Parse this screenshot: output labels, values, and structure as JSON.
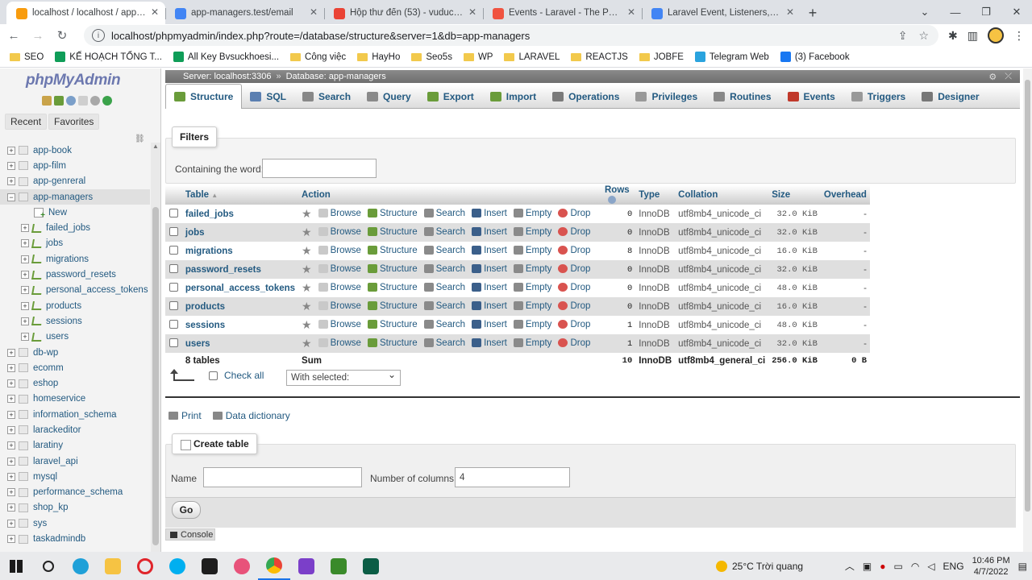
{
  "browser": {
    "tabs": [
      {
        "label": "localhost / localhost / app-mana",
        "active": true,
        "color": "#f89c0e"
      },
      {
        "label": "app-managers.test/email",
        "active": false,
        "color": "#4285f4"
      },
      {
        "label": "Hộp thư đến (53) - vuducnguyen",
        "active": false,
        "color": "#ea4335"
      },
      {
        "label": "Events - Laravel - The PHP Fram",
        "active": false,
        "color": "#f05340"
      },
      {
        "label": "Laravel Event, Listeners, Email &",
        "active": false,
        "color": "#4285f4"
      }
    ],
    "url": "localhost/phpmyadmin/index.php?route=/database/structure&server=1&db=app-managers",
    "bookmarks": [
      {
        "label": "SEO",
        "type": "folder"
      },
      {
        "label": "KẾ HOẠCH TỔNG T...",
        "type": "site",
        "color": "#0f9d58"
      },
      {
        "label": "All Key Bvsuckhoesi...",
        "type": "site",
        "color": "#0f9d58"
      },
      {
        "label": "Công việc",
        "type": "folder"
      },
      {
        "label": "HayHo",
        "type": "folder"
      },
      {
        "label": "Seo5s",
        "type": "folder"
      },
      {
        "label": "WP",
        "type": "folder"
      },
      {
        "label": "LARAVEL",
        "type": "folder"
      },
      {
        "label": "REACTJS",
        "type": "folder"
      },
      {
        "label": "JOBFE",
        "type": "folder"
      },
      {
        "label": "Telegram Web",
        "type": "site",
        "color": "#2aa3de"
      },
      {
        "label": "(3) Facebook",
        "type": "site",
        "color": "#1877f2"
      }
    ]
  },
  "leftpanel": {
    "logo_php": "php",
    "logo_myadmin": "MyAdmin",
    "tabs": [
      "Recent",
      "Favorites"
    ],
    "databases": [
      {
        "name": "app-book",
        "expanded": false
      },
      {
        "name": "app-film",
        "expanded": false
      },
      {
        "name": "app-genreral",
        "expanded": false
      },
      {
        "name": "app-managers",
        "expanded": true,
        "children": [
          "New",
          "failed_jobs",
          "jobs",
          "migrations",
          "password_resets",
          "personal_access_tokens",
          "products",
          "sessions",
          "users"
        ]
      },
      {
        "name": "db-wp",
        "expanded": false
      },
      {
        "name": "ecomm",
        "expanded": false
      },
      {
        "name": "eshop",
        "expanded": false
      },
      {
        "name": "homeservice",
        "expanded": false
      },
      {
        "name": "information_schema",
        "expanded": false
      },
      {
        "name": "larackeditor",
        "expanded": false
      },
      {
        "name": "laratiny",
        "expanded": false
      },
      {
        "name": "laravel_api",
        "expanded": false
      },
      {
        "name": "mysql",
        "expanded": false
      },
      {
        "name": "performance_schema",
        "expanded": false
      },
      {
        "name": "shop_kp",
        "expanded": false
      },
      {
        "name": "sys",
        "expanded": false
      },
      {
        "name": "taskadmindb",
        "expanded": false
      }
    ]
  },
  "breadcrumb": {
    "server": "Server: localhost:3306",
    "database": "Database: app-managers"
  },
  "menu": [
    {
      "label": "Structure",
      "active": true,
      "color": "#6a9c3a"
    },
    {
      "label": "SQL",
      "active": false,
      "color": "#5b7fb1"
    },
    {
      "label": "Search",
      "active": false,
      "color": "#888888"
    },
    {
      "label": "Query",
      "active": false,
      "color": "#8a8a8a"
    },
    {
      "label": "Export",
      "active": false,
      "color": "#6a9c3a"
    },
    {
      "label": "Import",
      "active": false,
      "color": "#6a9c3a"
    },
    {
      "label": "Operations",
      "active": false,
      "color": "#7a7a7a"
    },
    {
      "label": "Privileges",
      "active": false,
      "color": "#999999"
    },
    {
      "label": "Routines",
      "active": false,
      "color": "#888888"
    },
    {
      "label": "Events",
      "active": false,
      "color": "#c0392b"
    },
    {
      "label": "Triggers",
      "active": false,
      "color": "#999999"
    },
    {
      "label": "Designer",
      "active": false,
      "color": "#777777"
    }
  ],
  "filters": {
    "legend": "Filters",
    "label": "Containing the word:",
    "value": ""
  },
  "table": {
    "headers": {
      "table": "Table",
      "action": "Action",
      "rows": "Rows",
      "type": "Type",
      "collation": "Collation",
      "size": "Size",
      "overhead": "Overhead"
    },
    "action_labels": {
      "browse": "Browse",
      "structure": "Structure",
      "search": "Search",
      "insert": "Insert",
      "empty": "Empty",
      "drop": "Drop"
    },
    "rows": [
      {
        "name": "failed_jobs",
        "rows": "0",
        "type": "InnoDB",
        "collation": "utf8mb4_unicode_ci",
        "size": "32.0 KiB",
        "overhead": "-"
      },
      {
        "name": "jobs",
        "rows": "0",
        "type": "InnoDB",
        "collation": "utf8mb4_unicode_ci",
        "size": "32.0 KiB",
        "overhead": "-"
      },
      {
        "name": "migrations",
        "rows": "8",
        "type": "InnoDB",
        "collation": "utf8mb4_unicode_ci",
        "size": "16.0 KiB",
        "overhead": "-"
      },
      {
        "name": "password_resets",
        "rows": "0",
        "type": "InnoDB",
        "collation": "utf8mb4_unicode_ci",
        "size": "32.0 KiB",
        "overhead": "-"
      },
      {
        "name": "personal_access_tokens",
        "rows": "0",
        "type": "InnoDB",
        "collation": "utf8mb4_unicode_ci",
        "size": "48.0 KiB",
        "overhead": "-"
      },
      {
        "name": "products",
        "rows": "0",
        "type": "InnoDB",
        "collation": "utf8mb4_unicode_ci",
        "size": "16.0 KiB",
        "overhead": "-"
      },
      {
        "name": "sessions",
        "rows": "1",
        "type": "InnoDB",
        "collation": "utf8mb4_unicode_ci",
        "size": "48.0 KiB",
        "overhead": "-"
      },
      {
        "name": "users",
        "rows": "1",
        "type": "InnoDB",
        "collation": "utf8mb4_unicode_ci",
        "size": "32.0 KiB",
        "overhead": "-"
      }
    ],
    "footer": {
      "count": "8 tables",
      "sum": "Sum",
      "rows": "10",
      "type": "InnoDB",
      "collation": "utf8mb4_general_ci",
      "size": "256.0 KiB",
      "overhead": "0 B"
    }
  },
  "bulk": {
    "check_all": "Check all",
    "with_selected": "With selected:"
  },
  "links": {
    "print": "Print",
    "data_dictionary": "Data dictionary"
  },
  "create_table": {
    "legend": "Create table",
    "name_label": "Name",
    "name_value": "",
    "cols_label": "Number of columns:",
    "cols_value": "4",
    "go": "Go"
  },
  "console": "Console",
  "taskbar": {
    "weather": "25°C  Trời quang",
    "lang": "ENG",
    "time": "10:46 PM",
    "date": "4/7/2022"
  }
}
